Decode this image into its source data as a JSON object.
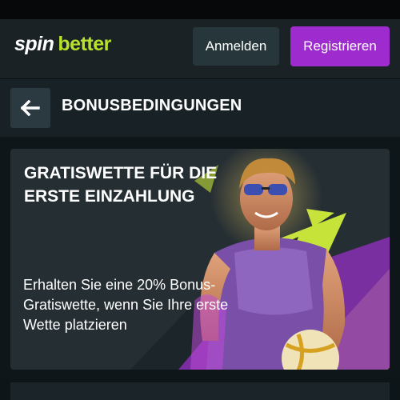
{
  "header": {
    "logo": {
      "part1": "spin",
      "part2": "better"
    },
    "login_label": "Anmelden",
    "register_label": "Registrieren"
  },
  "page": {
    "title": "BONUSBEDINGUNGEN",
    "back_icon": "arrow-left-icon"
  },
  "promo": {
    "title": "GRATISWETTE FÜR DIE ERSTE EINZAHLUNG",
    "description": "Erhalten Sie eine 20% Bonus-Gratiswette, wenn Sie Ihre erste Wette platzieren"
  },
  "colors": {
    "accent_green": "#b7e22a",
    "register_purple": "#9e2bce",
    "login_bg": "#26363b"
  }
}
